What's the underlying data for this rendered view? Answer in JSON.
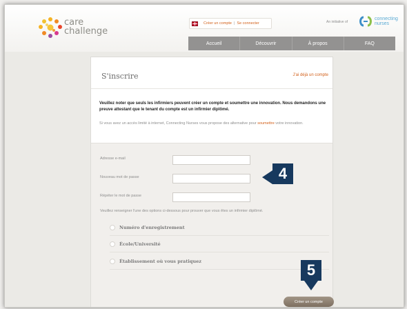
{
  "brand": {
    "line1": "care",
    "line2": "challenge"
  },
  "auth_links": {
    "create": "Créer un compte",
    "separator": "|",
    "login": "Se connecter"
  },
  "initiative": {
    "text": "An initiative of",
    "partner_line1": "connecting",
    "partner_line2": "nurses"
  },
  "nav": {
    "items": [
      "Accueil",
      "Découvrir",
      "À propos",
      "FAQ"
    ]
  },
  "card": {
    "title": "S'inscrire",
    "have_account": "J'ai déjà un compte",
    "notice": "Veuillez noter que seuls les infirmiers peuvent créer un compte et soumettre une innovation. Nous demandons une preuve attestant que le tenant du compte est un infirmier diplômé.",
    "internet_text": "Si vous avez un accès limité à internet, Connecting Nurses vous propose des alternative pour ",
    "internet_link": "soumettre",
    "internet_text_end": " votre innovation."
  },
  "form": {
    "email_label": "Adresse e-mail",
    "password_label": "Nouveau mot de passe",
    "repeat_label": "Répéter le mot de passe",
    "email_value": "",
    "password_value": "",
    "repeat_value": "",
    "instruction": "Veuillez renseigner l'une des options ci-dessous pour prouver que vous êtes un infirmier diplômé.",
    "options": [
      "Numéro d'enregistrement",
      "École/Université",
      "Établissement où vous pratiquez"
    ],
    "submit": "Créer un compte"
  },
  "callouts": {
    "step4": "4",
    "step5": "5"
  },
  "colors": {
    "accent": "#d2601a",
    "nav": "#939291",
    "badge": "#17395e",
    "button": "#8b7d6e",
    "partner": "#5aaad4"
  },
  "icons": {
    "brand_logo": "star-cluster-logo",
    "partner_logo": "connecting-nurses-logo",
    "flag": "uk-flag-icon"
  }
}
